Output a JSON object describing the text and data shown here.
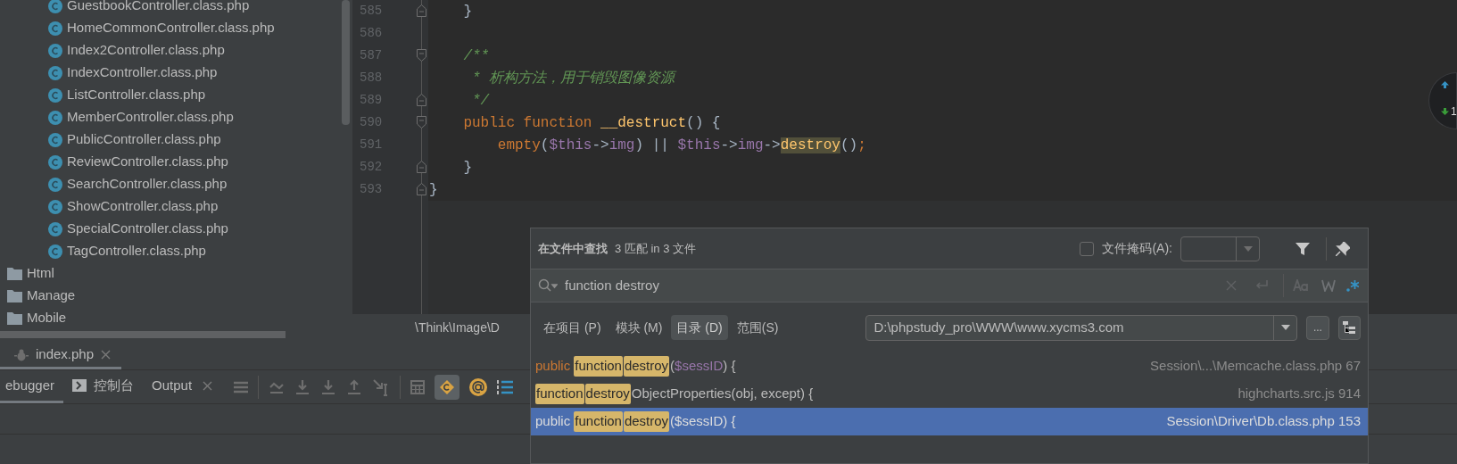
{
  "project_tree": {
    "items": [
      {
        "label": "GuestbookController.class.php",
        "kind": "class"
      },
      {
        "label": "HomeCommonController.class.php",
        "kind": "class"
      },
      {
        "label": "Index2Controller.class.php",
        "kind": "class"
      },
      {
        "label": "IndexController.class.php",
        "kind": "class"
      },
      {
        "label": "ListController.class.php",
        "kind": "class"
      },
      {
        "label": "MemberController.class.php",
        "kind": "class"
      },
      {
        "label": "PublicController.class.php",
        "kind": "class"
      },
      {
        "label": "ReviewController.class.php",
        "kind": "class"
      },
      {
        "label": "SearchController.class.php",
        "kind": "class"
      },
      {
        "label": "ShowController.class.php",
        "kind": "class"
      },
      {
        "label": "SpecialController.class.php",
        "kind": "class"
      },
      {
        "label": "TagController.class.php",
        "kind": "class"
      },
      {
        "label": "Html",
        "kind": "folder"
      },
      {
        "label": "Manage",
        "kind": "folder"
      },
      {
        "label": "Mobile",
        "kind": "folder"
      }
    ]
  },
  "editor": {
    "lines": [
      {
        "number": "585",
        "kind": "fold_end",
        "tokens": [
          {
            "text": "    }",
            "kind": "plain"
          }
        ]
      },
      {
        "number": "586",
        "kind": "plain"
      },
      {
        "number": "587",
        "kind": "fold_start",
        "tokens": [
          {
            "text": "    /**",
            "kind": "comment"
          }
        ]
      },
      {
        "number": "588",
        "kind": "plain",
        "tokens": [
          {
            "text": "     * 析构方法，用于销毁图像资源",
            "kind": "comment"
          }
        ]
      },
      {
        "number": "589",
        "kind": "fold_end",
        "tokens": [
          {
            "text": "     */",
            "kind": "comment"
          }
        ]
      },
      {
        "number": "590",
        "kind": "fold_start",
        "tokens": [
          {
            "text": "    public function ",
            "kind": "keyword"
          },
          {
            "text": "__destruct",
            "kind": "function"
          },
          {
            "text": "() {",
            "kind": "plain"
          }
        ]
      },
      {
        "number": "591",
        "kind": "plain",
        "tokens": [
          {
            "text": "        empty",
            "kind": "keyword"
          },
          {
            "text": "(",
            "kind": "plain"
          },
          {
            "text": "$this",
            "kind": "variable"
          },
          {
            "text": "->",
            "kind": "plain"
          },
          {
            "text": "img",
            "kind": "variable"
          },
          {
            "text": ") || ",
            "kind": "plain"
          },
          {
            "text": "$this",
            "kind": "variable"
          },
          {
            "text": "->",
            "kind": "plain"
          },
          {
            "text": "img",
            "kind": "variable"
          },
          {
            "text": "->",
            "kind": "plain"
          },
          {
            "text": "destroy",
            "kind": "highlight"
          },
          {
            "text": "()",
            "kind": "plain"
          },
          {
            "text": ";",
            "kind": "keyword"
          }
        ]
      },
      {
        "number": "592",
        "kind": "fold_end",
        "tokens": [
          {
            "text": "    }",
            "kind": "plain"
          }
        ]
      },
      {
        "number": "593",
        "kind": "fold_end",
        "tokens": [
          {
            "text": "}",
            "kind": "plain"
          }
        ]
      }
    ],
    "breadcrumb": "\\Think\\Image\\D"
  },
  "navigator": {
    "count": "1"
  },
  "find_popup": {
    "title": "在文件中查找",
    "summary": "3 匹配 in 3 文件",
    "file_mask": {
      "label": "文件掩码(A):",
      "checked": false
    },
    "query": "function destroy",
    "scopes": [
      {
        "label": "在项目 (P)",
        "selected": false
      },
      {
        "label": "模块 (M)",
        "selected": false
      },
      {
        "label": "目录 (D)",
        "selected": true
      },
      {
        "label": "范围(S)",
        "selected": false
      }
    ],
    "directory": "D:\\phpstudy_pro\\WWW\\www.xycms3.com",
    "browse_label": "...",
    "results": [
      {
        "selected": false,
        "location": "Session\\...\\Memcache.class.php 67",
        "segments": [
          {
            "text": "public ",
            "kind": "keyword"
          },
          {
            "text": "function",
            "kind": "match"
          },
          {
            "text": "destroy",
            "kind": "match"
          },
          {
            "text": "(",
            "kind": "plain"
          },
          {
            "text": "$sessID",
            "kind": "variable"
          },
          {
            "text": ") {",
            "kind": "plain"
          }
        ]
      },
      {
        "selected": false,
        "location": "highcharts.src.js 914",
        "segments": [
          {
            "text": "function",
            "kind": "match"
          },
          {
            "text": "destroy",
            "kind": "match"
          },
          {
            "text": "ObjectProperties(obj, except) {",
            "kind": "plain"
          }
        ]
      },
      {
        "selected": true,
        "location": "Session\\Driver\\Db.class.php 153",
        "segments": [
          {
            "text": "public ",
            "kind": "keyword"
          },
          {
            "text": "function",
            "kind": "match"
          },
          {
            "text": "destroy",
            "kind": "match"
          },
          {
            "text": "(",
            "kind": "plain"
          },
          {
            "text": "$sessID",
            "kind": "variable"
          },
          {
            "text": ") {",
            "kind": "plain"
          }
        ]
      }
    ]
  },
  "run_panel": {
    "session_tab": "index.php",
    "tabs": [
      {
        "label": "ebugger",
        "kind": "text",
        "selected": true
      },
      {
        "label": "控制台",
        "kind": "console",
        "selected": false
      },
      {
        "label": "Output",
        "kind": "closable",
        "selected": false
      }
    ]
  }
}
